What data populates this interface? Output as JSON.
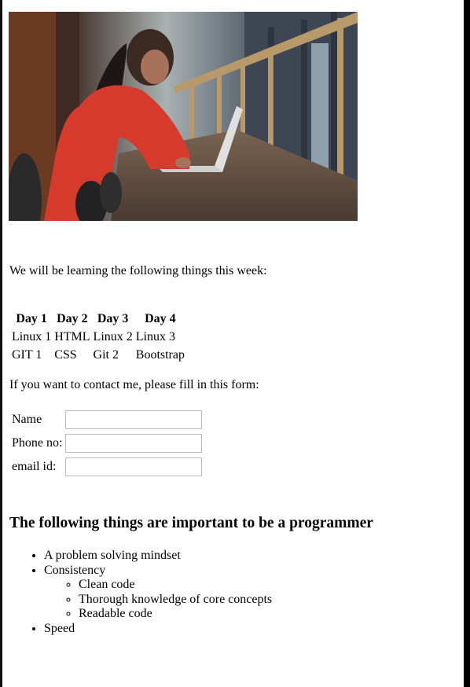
{
  "intro_text": "We will be learning the following things this week:",
  "schedule": {
    "headers": [
      "Day 1",
      "Day 2",
      "Day 3",
      "Day 4"
    ],
    "rows": [
      [
        "Linux 1",
        "HTML",
        "Linux 2",
        "Linux 3"
      ],
      [
        "GIT 1",
        "CSS",
        "Git 2",
        "Bootstrap"
      ]
    ]
  },
  "contact_text": "If you want to contact me, please fill in this form:",
  "form": {
    "name_label": "Name",
    "phone_label": "Phone no:",
    "email_label": "email id:",
    "name_value": "",
    "phone_value": "",
    "email_value": ""
  },
  "heading": "The following things are important to be a programmer",
  "list": {
    "item1": "A problem solving mindset",
    "item2": "Consistency",
    "sub": [
      "Clean code",
      "Thorough knowledge of core concepts",
      "Readable code"
    ],
    "item3": "Speed"
  },
  "colors": {
    "sweater": "#d63a2c",
    "desk": "#5e4a3c",
    "railing": "#b89a6a",
    "wall": "#3d4652"
  }
}
